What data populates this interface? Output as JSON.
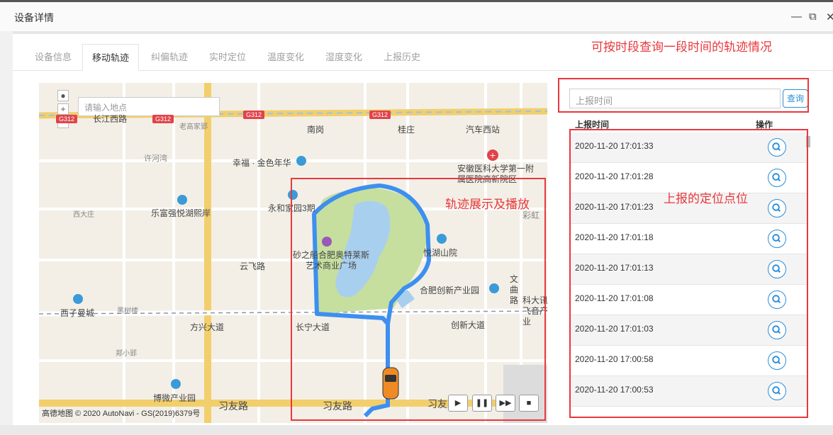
{
  "window": {
    "title": "设备详情",
    "minimize_icon": "minimize-icon",
    "maximize_icon": "maximize-icon",
    "close_icon": "close-icon",
    "close_glyph": "✕",
    "max_glyph": "⧉",
    "min_glyph": "—"
  },
  "tabs": [
    {
      "label": "设备信息",
      "active": false
    },
    {
      "label": "移动轨迹",
      "active": true
    },
    {
      "label": "纠偏轨迹",
      "active": false
    },
    {
      "label": "实时定位",
      "active": false
    },
    {
      "label": "温度变化",
      "active": false
    },
    {
      "label": "湿度变化",
      "active": false
    },
    {
      "label": "上报历史",
      "active": false
    }
  ],
  "annotations": {
    "top": "可按时段查询一段时间的轨迹情况",
    "map": "轨迹展示及播放",
    "list": "上报的定位点位"
  },
  "map": {
    "search_placeholder": "请输入地点",
    "zoom_in": "+",
    "zoom_out": "−",
    "copyright": "高德地图 © 2020 AutoNavi - GS(2019)6379号",
    "road_badges": [
      "G312",
      "G312",
      "G312",
      "G312"
    ],
    "labels": {
      "nangang": "南岗",
      "guizhuang": "桂庄",
      "qichexizhan": "汽车西站",
      "changjiangxilu": "长江西路",
      "laowangjiaying": "老高家郢",
      "xuhewan": "许河湾",
      "xingfu": "幸福 · 金色年华",
      "anhui_hosp": "安徽医科大学第一附属医院高新院区",
      "yonghe": "永和家园3期",
      "xidazhuang": "西大庄",
      "leyuan": "乐富强悦湖熙岸",
      "shazhou": "砂之船合肥奥特莱斯艺术商业广场",
      "yuehu": "悦湖山院",
      "yunfeilu": "云飞路",
      "hefei_cyy": "合肥创新产业园",
      "wenqu": "文曲路",
      "keda": "科大讯飞音产业",
      "xizimancheng": "西子曼城",
      "heishu": "黑树楼",
      "fangxing": "方兴大道",
      "changning": "长宁大道",
      "chuangxin": "创新大道",
      "zhengxiaoying": "郑小郢",
      "bowei": "博微产业园",
      "xiyoulu": "习友路",
      "xiyoulu2": "习友路",
      "xiyoulu3": "习友路",
      "caihong": "彩虹"
    },
    "playback": {
      "play_icon": "play-icon",
      "pause_icon": "pause-icon",
      "forward_icon": "fast-forward-icon",
      "stop_icon": "stop-icon",
      "play_glyph": "▶",
      "pause_glyph": "❚❚",
      "forward_glyph": "▶▶",
      "stop_glyph": "■"
    }
  },
  "query": {
    "placeholder": "上报时间",
    "button": "查询"
  },
  "table": {
    "col_time": "上报时间",
    "col_action": "操作",
    "rows": [
      "2020-11-20 17:01:33",
      "2020-11-20 17:01:28",
      "2020-11-20 17:01:23",
      "2020-11-20 17:01:18",
      "2020-11-20 17:01:13",
      "2020-11-20 17:01:08",
      "2020-11-20 17:01:03",
      "2020-11-20 17:00:58",
      "2020-11-20 17:00:53"
    ],
    "action_icon": "search-icon"
  },
  "colors": {
    "accent": "#2b8ed8",
    "annotation": "#e8383d",
    "route": "#3d8ff0",
    "lake": "#a9cfee",
    "park": "#c6df9f"
  }
}
